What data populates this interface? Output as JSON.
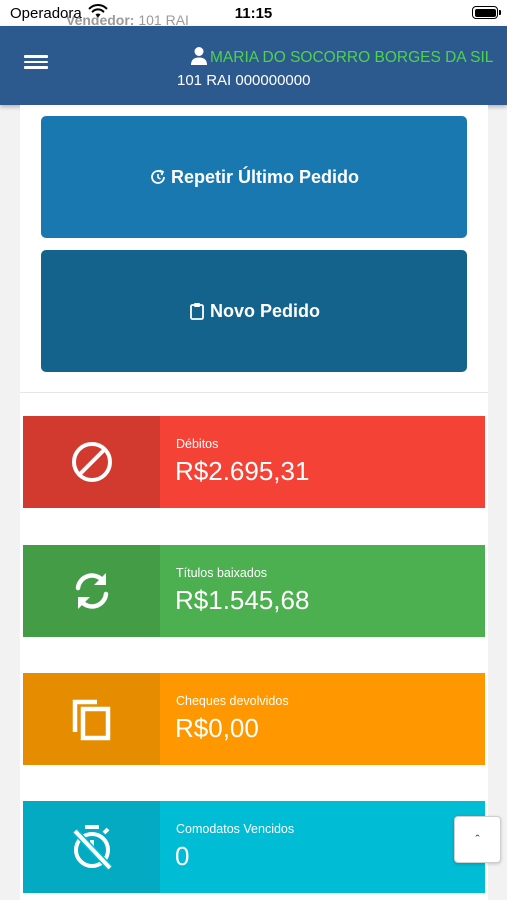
{
  "status_bar": {
    "carrier": "Operadora",
    "time": "11:15",
    "ghost_label": "Vendedor:",
    "ghost_value": "101 RAI"
  },
  "header": {
    "customer_name": "MARIA DO SOCORRO BORGES DA SIL",
    "customer_code": "101 RAI 000000000",
    "menu_icon": "hamburger-icon",
    "user_icon": "person-icon"
  },
  "actions": {
    "repeat_label": "Repetir Último Pedido",
    "repeat_icon": "clock-arrow-icon",
    "new_label": "Novo Pedido",
    "new_icon": "clipboard-icon"
  },
  "stats": {
    "debitos": {
      "label": "Débitos",
      "value": "R$2.695,31",
      "icon": "block-icon"
    },
    "titulos": {
      "label": "Títulos baixados",
      "value": "R$1.545,68",
      "icon": "sync-icon"
    },
    "cheques": {
      "label": "Cheques devolvidos",
      "value": "R$0,00",
      "icon": "copy-icon"
    },
    "comodatos": {
      "label": "Comodatos Vencidos",
      "value": "0",
      "icon": "timer-off-icon"
    }
  },
  "scroll_top": {
    "label": "ˆ",
    "icon": "chevron-up-icon"
  },
  "colors": {
    "header_bg": "#2c5a8f",
    "customer_name": "#4cd44c",
    "repeat_btn": "#1a78b1",
    "new_btn": "#14638c",
    "debitos": "#f44336",
    "titulos": "#4caf50",
    "cheques": "#ff9800",
    "comodatos": "#00bcd4"
  }
}
